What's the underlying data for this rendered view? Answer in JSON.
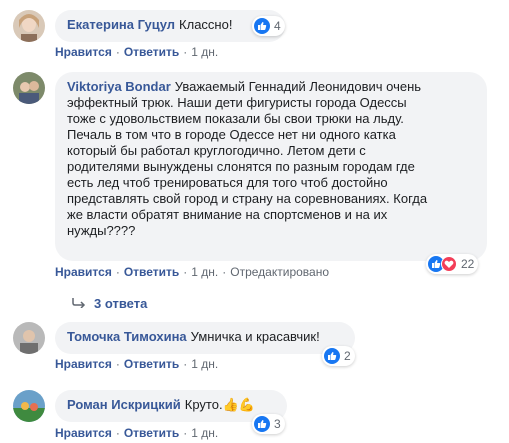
{
  "comments": [
    {
      "author": "Екатерина Гуцул",
      "text": "Классно!",
      "like": "Нравится",
      "reply": "Ответить",
      "time": "1 дн.",
      "reactions": "4",
      "reaction_icons": [
        "like-icon"
      ]
    },
    {
      "author": "Viktoriya Bondar",
      "text_lines": [
        "Уважаемый Геннадий Леонидович очень",
        "эффектный трюк. Наши дети фигуристы города Одессы",
        "тоже с удовольствием показали бы свои трюки на льду.",
        "Печаль в том что в городе Одессе нет ни одного катка",
        "который бы работал круглогодично. Летом дети с",
        "родителями вынуждены слонятся по разным городам где",
        "есть лед чтоб тренироваться для того чтоб достойно",
        "представлять свой город и страну на соревнованиях. Когда",
        "же власти обратят внимание на спортсменов и на их",
        "нужды????"
      ],
      "like": "Нравится",
      "reply": "Ответить",
      "time": "1 дн.",
      "edited": "Отредактировано",
      "reactions": "22",
      "reaction_icons": [
        "like-icon",
        "love-icon"
      ]
    },
    {
      "author": "Томочка Тимохина",
      "text": "Умничка и красавчик!",
      "like": "Нравится",
      "reply": "Ответить",
      "time": "1 дн.",
      "reactions": "2",
      "reaction_icons": [
        "like-icon"
      ]
    },
    {
      "author": "Роман Искрицкий",
      "text": "Круто.",
      "emoji": "👍💪",
      "like": "Нравится",
      "reply": "Ответить",
      "time": "1 дн.",
      "reactions": "3",
      "reaction_icons": [
        "like-icon"
      ]
    }
  ],
  "replies_link": "3 ответа",
  "colors": {
    "author": "#385898",
    "bubble": "#f2f3f5",
    "like": "#1877f2",
    "love": "#f33e58",
    "meta": "#606770"
  }
}
